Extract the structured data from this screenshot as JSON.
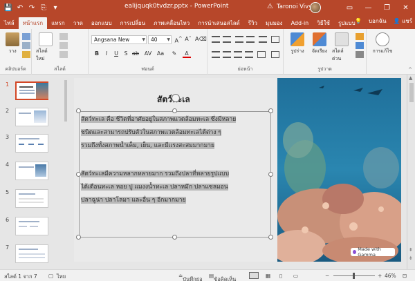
{
  "window": {
    "doc_title": "ealijquqk0tvdzr.pptx - PowerPoint",
    "user_name": "Taronoi Vivy",
    "minimize": "—",
    "restore": "❐",
    "close": "✕"
  },
  "qat": {
    "save": "💾",
    "undo": "↶",
    "redo": "↷",
    "start": "⎘",
    "more": "▾"
  },
  "tabs": [
    {
      "label": "ไฟล์"
    },
    {
      "label": "หน้าแรก"
    },
    {
      "label": "แทรก"
    },
    {
      "label": "วาด"
    },
    {
      "label": "ออกแบบ"
    },
    {
      "label": "การเปลี่ยน"
    },
    {
      "label": "ภาพเคลื่อนไหว"
    },
    {
      "label": "การนำเสนอสไลด์"
    },
    {
      "label": "รีวิว"
    },
    {
      "label": "มุมมอง"
    },
    {
      "label": "Add-in"
    },
    {
      "label": "วิธีใช้"
    },
    {
      "label": "รูปแบบ"
    }
  ],
  "tell_me": "บอกฉัน",
  "share": "แชร์",
  "ribbon": {
    "paste": "วาง",
    "new_slide": "สไลด์ใหม่",
    "clipboard": "คลิปบอร์ด",
    "slides": "สไลด์",
    "font_name": "Angsana New",
    "font_size": "40",
    "bold": "B",
    "italic": "I",
    "underline": "U",
    "strike": "S",
    "font_group": "ฟอนต์",
    "paragraph_group": "ย่อหน้า",
    "shapes": "รูปร่าง",
    "arrange": "จัดเรียง",
    "quick_styles": "สไตล์ด่วน",
    "drawing_group": "รูปวาด",
    "editing": "การแก้ไข"
  },
  "slide_numbers": [
    "1",
    "2",
    "3",
    "4",
    "5",
    "6",
    "7"
  ],
  "slide": {
    "title": "สัตว์ทะเล",
    "para1_lines": [
      "สัตว์ทะเล คือ ชีวิตที่อาศัยอยู่ในสภาพแวดล้อมทะเล ซึ่งมีหลาย",
      "ชนิดและสามารถปรับตัวในสภาพแวดล้อมทะเลได้ต่าง ๆ",
      "รวมถึงทั้งสภาพน้ำเค็ม, เย็น, และมีแรงสะสมมากมาย"
    ],
    "para2_lines": [
      "สัตว์ทะเลมีความหลากหลายมาก รวมถึงปลาที่หลายรูปแบบ",
      "ได้เดือนทะเล หอย ปู แมงงน้ำทะเล ปลาหมึก ปลาแซลมอน",
      "ปลาฉูน่า ปลาโลมา และอื่น ๆ อีกมากมาย"
    ],
    "badge": "Made with Gamma"
  },
  "status": {
    "slide_of": "สไลด์ 1 จาก 7",
    "language": "ไทย",
    "notes": "บันทึกย่อ",
    "comments": "ข้อคิดเห็น",
    "zoom": "46%"
  },
  "colors": {
    "accent": "#b7472a",
    "selection": "#d24726"
  }
}
